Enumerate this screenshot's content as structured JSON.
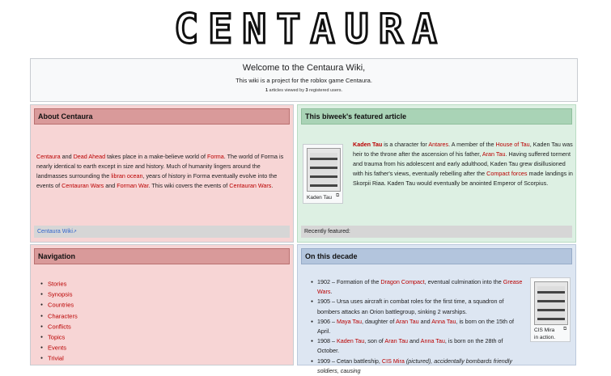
{
  "logo": "CENTAURA",
  "welcome": {
    "title": "Welcome to the Centaura Wiki,",
    "subtitle": "This wiki is a project for the roblox game Centaura.",
    "stats_articles": "1",
    "stats_mid": " articles viewed by ",
    "stats_users": "3",
    "stats_end": " registered users."
  },
  "about": {
    "heading": "About Centaura",
    "text": [
      "Centaura",
      " and ",
      "Dead Ahead",
      " takes place in a make-believe world of ",
      "Forma",
      ". The world of Forma is nearly identical to earth except in size and history. Much of humanity lingers around the landmasses surrounding the ",
      "libran ocean",
      ", years of history in Forma eventually evolve into the events of ",
      "Centauran Wars",
      " and ",
      "Forman War",
      ". This wiki covers the events of ",
      "Centauran Wars",
      "."
    ],
    "footer_link": "Centaura Wiki"
  },
  "featured": {
    "heading": "This biweek's featured article",
    "thumb_caption": "Kaden Tau",
    "text": [
      "Kaden Tau",
      " is a character for ",
      "Antares",
      ". A member of the ",
      "House of Tau",
      ", Kaden Tau was heir to the throne after the ascension of his father, ",
      "Aran Tau",
      ". Having suffered torment and trauma from his adolescent and early adulthood, Kaden Tau grew disillusioned with his father's views, eventually rebelling after the ",
      "Compact forces",
      " made landings in Skorpii Riaa. Kaden Tau would eventually be anointed Emperor of Scorpius."
    ],
    "recent_label": "Recently featured:"
  },
  "navigation": {
    "heading": "Navigation",
    "items": [
      "Stories",
      "Synopsis",
      "Countries",
      "Characters",
      "Conflicts",
      "Topics",
      "Events",
      "Trivial"
    ]
  },
  "decade": {
    "heading": "On this decade",
    "thumb_caption_1": "CIS Mira",
    "thumb_caption_2": "in action.",
    "events": [
      [
        "1902 – Formation of the ",
        "Dragon Compact",
        ", eventual culmination into the ",
        "Grease Wars",
        "."
      ],
      [
        "1905 – Ursa uses aircraft in combat roles for the first time, a squadron of bombers attacks an Orion battlegroup, sinking 2 warships."
      ],
      [
        "1906 – ",
        "Maya Tau",
        ", daughter of ",
        "Aran Tau",
        " and ",
        "Anna Tau",
        ", is born on the 15th of April."
      ],
      [
        "1908 – ",
        "Kaden Tau",
        ", son of ",
        "Aran Tau",
        " and ",
        "Anna Tau",
        ", is born on the 28th of October."
      ],
      [
        "1909 – Cetan battleship, ",
        "CIS Mira",
        " (pictured), accidentally bombards friendly soldiers, causing"
      ]
    ]
  }
}
